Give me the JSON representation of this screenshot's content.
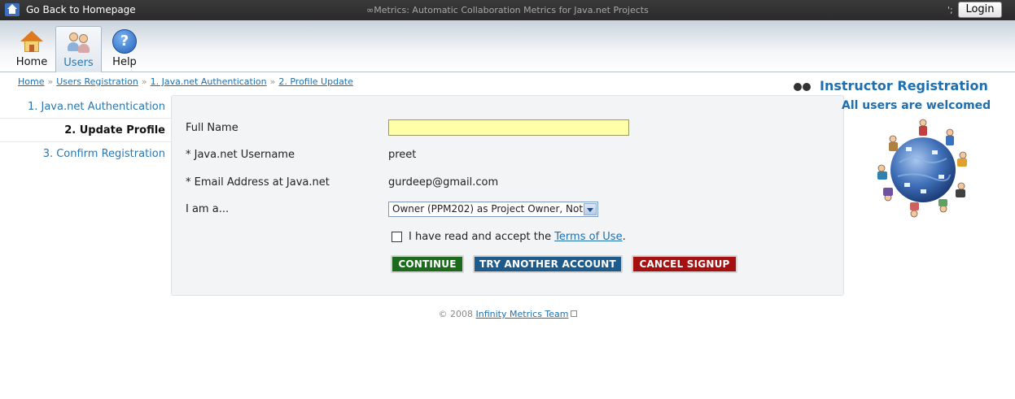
{
  "topbar": {
    "home_link": "Go Back to Homepage",
    "title": "∞Metrics: Automatic Collaboration Metrics for Java.net Projects",
    "separator": "';",
    "login": "Login"
  },
  "toolbar": {
    "items": [
      {
        "label": "Home",
        "icon": "home-icon"
      },
      {
        "label": "Users",
        "icon": "users-icon",
        "active": true
      },
      {
        "label": "Help",
        "icon": "help-icon"
      }
    ]
  },
  "breadcrumb": {
    "items": [
      "Home",
      "Users Registration",
      "1. Java.net Authentication",
      "2. Profile Update"
    ],
    "separator": "»"
  },
  "steps": [
    {
      "label": "1. Java.net Authentication"
    },
    {
      "label": "2. Update Profile",
      "current": true
    },
    {
      "label": "3. Confirm Registration"
    }
  ],
  "form": {
    "full_name_label": "Full Name",
    "full_name_value": "",
    "username_label": "* Java.net Username",
    "username_value": "preet",
    "email_label": "* Email Address at Java.net",
    "email_value": "gurdeep@gmail.com",
    "role_label": "I am a...",
    "role_value": "Owner (PPM202) as Project Owner, Not",
    "terms_prefix": "I have read and accept the ",
    "terms_link": "Terms of Use",
    "terms_suffix": ".",
    "continue": "CONTINUE",
    "try_another": "TRY ANOTHER ACCOUNT",
    "cancel": "CANCEL SIGNUP"
  },
  "sidebar_right": {
    "title": "Instructor Registration",
    "subtitle": "All users are welcomed"
  },
  "footer": {
    "copyright": "© 2008 ",
    "team_link": "Infinity Metrics Team"
  },
  "colors": {
    "accent": "#1f6fae",
    "continue": "#1c6a1c",
    "try_another": "#1e5a8a",
    "cancel": "#a51010",
    "input_highlight": "#ffffa8"
  }
}
